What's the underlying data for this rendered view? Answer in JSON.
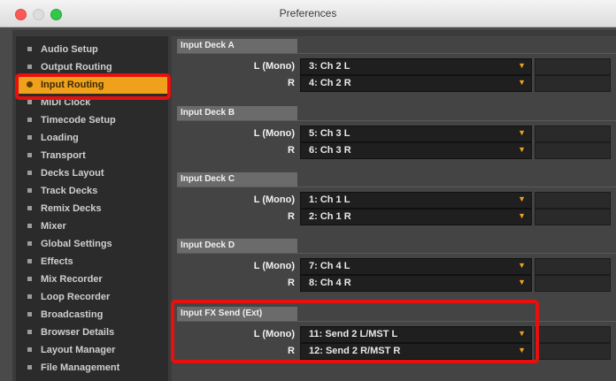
{
  "window": {
    "title": "Preferences"
  },
  "sidebar": {
    "items": [
      {
        "label": "Audio Setup",
        "active": false
      },
      {
        "label": "Output Routing",
        "active": false
      },
      {
        "label": "Input Routing",
        "active": true
      },
      {
        "label": "MIDI Clock",
        "active": false
      },
      {
        "label": "Timecode Setup",
        "active": false
      },
      {
        "label": "Loading",
        "active": false
      },
      {
        "label": "Transport",
        "active": false
      },
      {
        "label": "Decks Layout",
        "active": false
      },
      {
        "label": "Track Decks",
        "active": false
      },
      {
        "label": "Remix Decks",
        "active": false
      },
      {
        "label": "Mixer",
        "active": false
      },
      {
        "label": "Global Settings",
        "active": false
      },
      {
        "label": "Effects",
        "active": false
      },
      {
        "label": "Mix Recorder",
        "active": false
      },
      {
        "label": "Loop Recorder",
        "active": false
      },
      {
        "label": "Broadcasting",
        "active": false
      },
      {
        "label": "Browser Details",
        "active": false
      },
      {
        "label": "Layout Manager",
        "active": false
      },
      {
        "label": "File Management",
        "active": false
      }
    ]
  },
  "sections": [
    {
      "title": "Input Deck A",
      "left_label": "L (Mono)",
      "left_value": "3: Ch 2 L",
      "right_label": "R",
      "right_value": "4: Ch 2 R"
    },
    {
      "title": "Input Deck B",
      "left_label": "L (Mono)",
      "left_value": "5: Ch 3 L",
      "right_label": "R",
      "right_value": "6: Ch 3 R"
    },
    {
      "title": "Input Deck C",
      "left_label": "L (Mono)",
      "left_value": "1: Ch 1 L",
      "right_label": "R",
      "right_value": "2: Ch 1 R"
    },
    {
      "title": "Input Deck D",
      "left_label": "L (Mono)",
      "left_value": "7: Ch 4 L",
      "right_label": "R",
      "right_value": "8: Ch 4 R"
    },
    {
      "title": "Input FX Send (Ext)",
      "left_label": "L (Mono)",
      "left_value": "11: Send 2 L/MST L",
      "right_label": "R",
      "right_value": "12: Send 2 R/MST R"
    }
  ],
  "colors": {
    "accent": "#f0a11c",
    "highlight_outline": "#e8100f",
    "sidebar_bg": "#2b2b2b",
    "content_bg": "#444444"
  },
  "icons": {
    "dropdown": "chevron-down-icon",
    "bullet": "square-bullet-icon"
  }
}
